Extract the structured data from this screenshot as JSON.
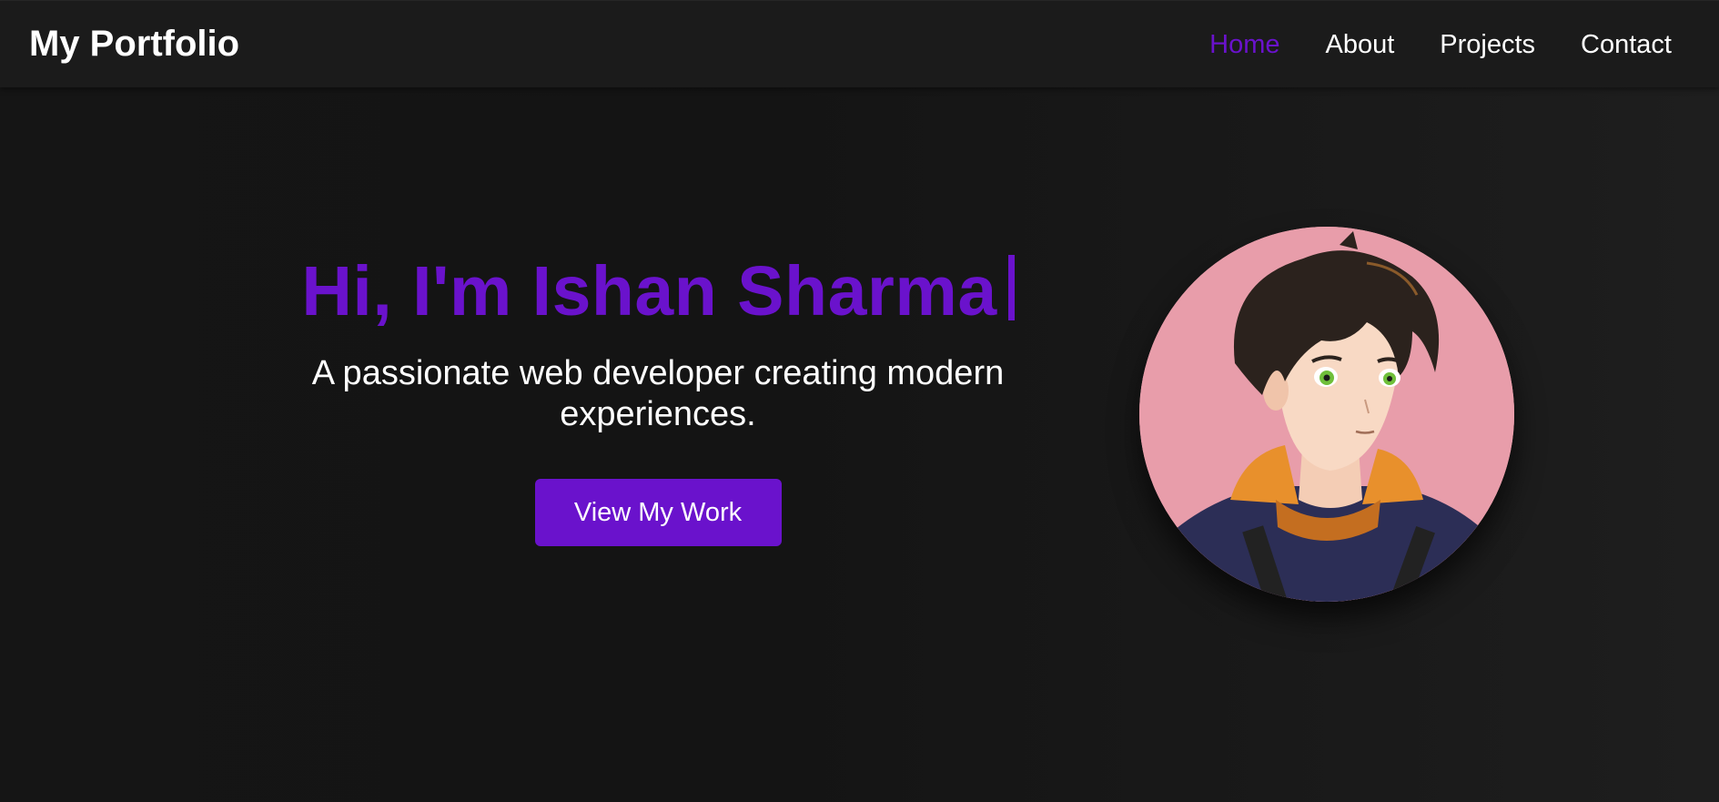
{
  "brand": {
    "title": "My Portfolio"
  },
  "nav": {
    "items": [
      {
        "label": "Home",
        "active": true
      },
      {
        "label": "About",
        "active": false
      },
      {
        "label": "Projects",
        "active": false
      },
      {
        "label": "Contact",
        "active": false
      }
    ]
  },
  "hero": {
    "heading": "Hi, I'm Ishan Sharma",
    "subtitle": "A passionate web developer creating modern experiences.",
    "button_label": "View My Work"
  },
  "colors": {
    "accent": "#6a12cc",
    "background": "#161616",
    "navbar": "#1b1b1b",
    "text": "#ffffff",
    "avatar_background": "#e79fae"
  },
  "avatar": {
    "icon": "anime-boy-avatar"
  }
}
